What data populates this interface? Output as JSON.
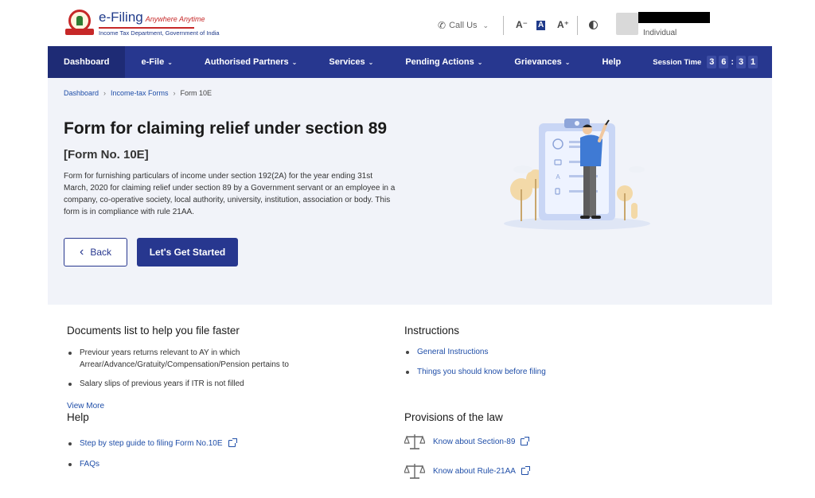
{
  "header": {
    "logo_title": "e-Filing",
    "logo_tag": "Anywhere Anytime",
    "logo_sub": "Income Tax Department, Government of India",
    "call_us": "Call Us",
    "font_decrease": "A⁻",
    "font_default": "A",
    "font_increase": "A⁺",
    "user_role": "Individual"
  },
  "nav": {
    "items": [
      {
        "label": "Dashboard",
        "caret": ""
      },
      {
        "label": "e-File",
        "caret": "⌄"
      },
      {
        "label": "Authorised Partners",
        "caret": "⌄"
      },
      {
        "label": "Services",
        "caret": "⌄"
      },
      {
        "label": "Pending Actions",
        "caret": "⌄"
      },
      {
        "label": "Grievances",
        "caret": "⌄"
      },
      {
        "label": "Help",
        "caret": ""
      }
    ],
    "session_label": "Session Time",
    "session_digits": [
      "3",
      "6",
      "3",
      "1"
    ],
    "session_sep": ":"
  },
  "breadcrumb": {
    "items": [
      "Dashboard",
      "Income-tax Forms",
      "Form 10E"
    ],
    "sep": "›"
  },
  "hero": {
    "title": "Form for claiming relief under section 89",
    "form_no": "[Form No. 10E]",
    "description": "Form for furnishing particulars of income under section 192(2A) for the year ending 31st March, 2020 for claiming relief under section 89 by a Government servant or an employee in a company, co-operative society, local authority, university, institution, association or body. This form is in compliance with rule 21AA.",
    "back_label": "Back",
    "back_chevron": "‹",
    "start_label": "Let's Get Started"
  },
  "documents": {
    "title": "Documents list to help you file faster",
    "items": [
      "Previour years returns relevant to AY in which Arrear/Advance/Gratuity/Compensation/Pension pertains to",
      "Salary slips of previous years if ITR is not filled"
    ],
    "view_more": "View More"
  },
  "help": {
    "title": "Help",
    "items": [
      "Step by step guide to filing Form No.10E",
      "FAQs"
    ]
  },
  "instructions": {
    "title": "Instructions",
    "items": [
      "General Instructions",
      "Things you should know before filing"
    ]
  },
  "law": {
    "title": "Provisions of the law",
    "items": [
      "Know about Section-89",
      "Know about Rule-21AA"
    ]
  },
  "colors": {
    "nav": "#27378f",
    "link": "#1f4ea8",
    "hero_bg": "#f1f3f9"
  }
}
